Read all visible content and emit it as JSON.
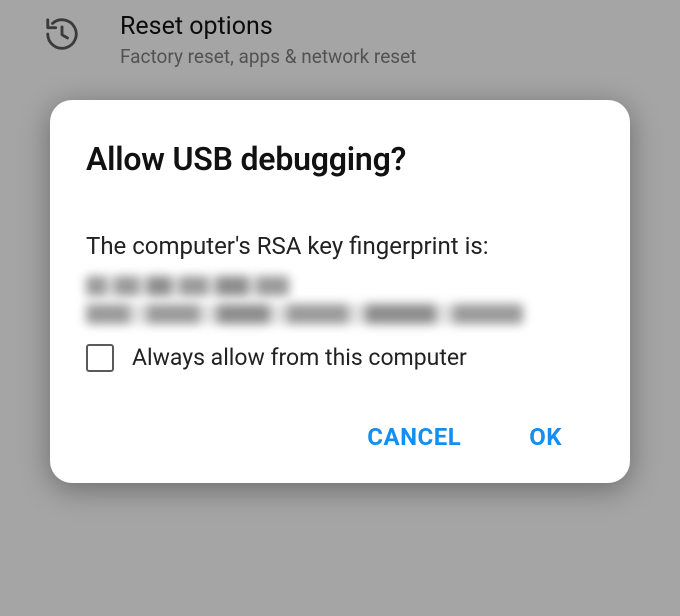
{
  "background": {
    "reset_options": {
      "title": "Reset options",
      "subtitle": "Factory reset, apps & network reset",
      "icon": "history-icon"
    }
  },
  "dialog": {
    "title": "Allow USB debugging?",
    "message": "The computer's RSA key fingerprint is:",
    "fingerprint_redacted": true,
    "checkbox": {
      "label": "Always allow from this computer",
      "checked": false
    },
    "actions": {
      "cancel": "CANCEL",
      "ok": "OK"
    }
  }
}
